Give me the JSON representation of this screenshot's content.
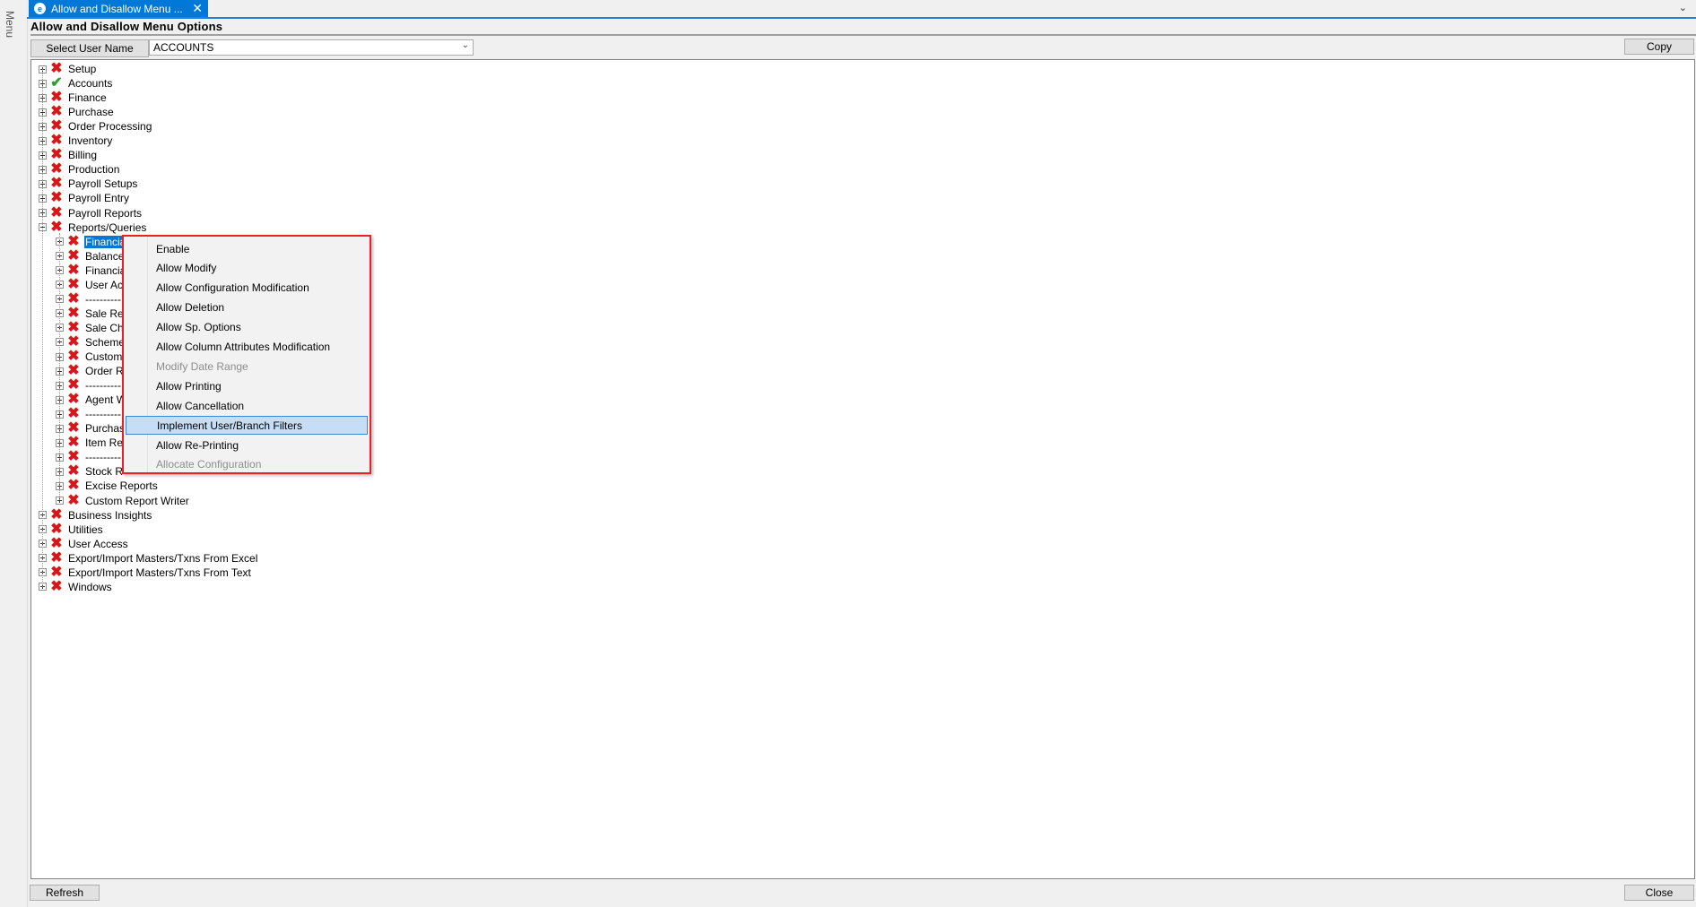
{
  "sidebar": {
    "menu_label": "Menu"
  },
  "tab": {
    "title": "Allow and Disallow Menu ...",
    "close_glyph": "✕",
    "logo_glyph": "e"
  },
  "form": {
    "title": "Allow and Disallow Menu Options",
    "select_user_label": "Select User Name",
    "selected_user": "ACCOUNTS",
    "copy_label": "Copy",
    "refresh_label": "Refresh",
    "close_label": "Close"
  },
  "tree": {
    "top_nodes": [
      {
        "label": "Setup",
        "status": "x"
      },
      {
        "label": "Accounts",
        "status": "check"
      },
      {
        "label": "Finance",
        "status": "x"
      },
      {
        "label": "Purchase",
        "status": "x"
      },
      {
        "label": "Order Processing",
        "status": "x"
      },
      {
        "label": "Inventory",
        "status": "x"
      },
      {
        "label": "Billing",
        "status": "x"
      },
      {
        "label": "Production",
        "status": "x"
      },
      {
        "label": "Payroll Setups",
        "status": "x"
      },
      {
        "label": "Payroll Entry",
        "status": "x"
      },
      {
        "label": "Payroll Reports",
        "status": "x"
      },
      {
        "label": "Reports/Queries",
        "status": "x",
        "expanded": true
      }
    ],
    "reports_children": [
      {
        "label": "Financial",
        "status": "x",
        "selected": true
      },
      {
        "label": "Balance",
        "status": "x"
      },
      {
        "label": "Financial",
        "status": "x"
      },
      {
        "label": "User Ac",
        "status": "x"
      },
      {
        "label": "----------",
        "status": "x"
      },
      {
        "label": "Sale Re",
        "status": "x"
      },
      {
        "label": "Sale Ch",
        "status": "x"
      },
      {
        "label": "Scheme",
        "status": "x"
      },
      {
        "label": "Custome",
        "status": "x"
      },
      {
        "label": "Order R",
        "status": "x"
      },
      {
        "label": "----------",
        "status": "x"
      },
      {
        "label": "Agent W",
        "status": "x"
      },
      {
        "label": "----------",
        "status": "x"
      },
      {
        "label": "Purchas",
        "status": "x"
      },
      {
        "label": "Item Re",
        "status": "x"
      },
      {
        "label": "----------",
        "status": "x"
      },
      {
        "label": "Stock R",
        "status": "x"
      },
      {
        "label": "Excise Reports",
        "status": "x"
      },
      {
        "label": "Custom Report Writer",
        "status": "x"
      }
    ],
    "bottom_nodes": [
      {
        "label": "Business Insights",
        "status": "x"
      },
      {
        "label": "Utilities",
        "status": "x"
      },
      {
        "label": "User Access",
        "status": "x"
      },
      {
        "label": "Export/Import Masters/Txns From Excel",
        "status": "x"
      },
      {
        "label": "Export/Import Masters/Txns From Text",
        "status": "x"
      },
      {
        "label": "Windows",
        "status": "x"
      }
    ]
  },
  "context_menu": {
    "items": [
      {
        "label": "Enable",
        "enabled": true
      },
      {
        "label": "Allow Modify",
        "enabled": true
      },
      {
        "label": "Allow Configuration Modification",
        "enabled": true
      },
      {
        "label": "Allow Deletion",
        "enabled": true
      },
      {
        "label": "Allow Sp. Options",
        "enabled": true
      },
      {
        "label": "Allow Column Attributes Modification",
        "enabled": true
      },
      {
        "label": "Modify Date Range",
        "enabled": false
      },
      {
        "label": "Allow Printing",
        "enabled": true
      },
      {
        "label": "Allow Cancellation",
        "enabled": true
      },
      {
        "label": "Implement User/Branch Filters",
        "enabled": true,
        "highlighted": true
      },
      {
        "label": "Allow Re-Printing",
        "enabled": true
      },
      {
        "label": "Allocate Configuration",
        "enabled": false
      }
    ]
  },
  "icons": {
    "x": "✖",
    "check": "✔",
    "dropdown": "⌄",
    "tab_overflow": "⌄"
  },
  "colors": {
    "accent": "#0078d7",
    "error_x": "#d81818",
    "ok_check": "#2e9e2e",
    "menu_border": "#e8202a"
  }
}
